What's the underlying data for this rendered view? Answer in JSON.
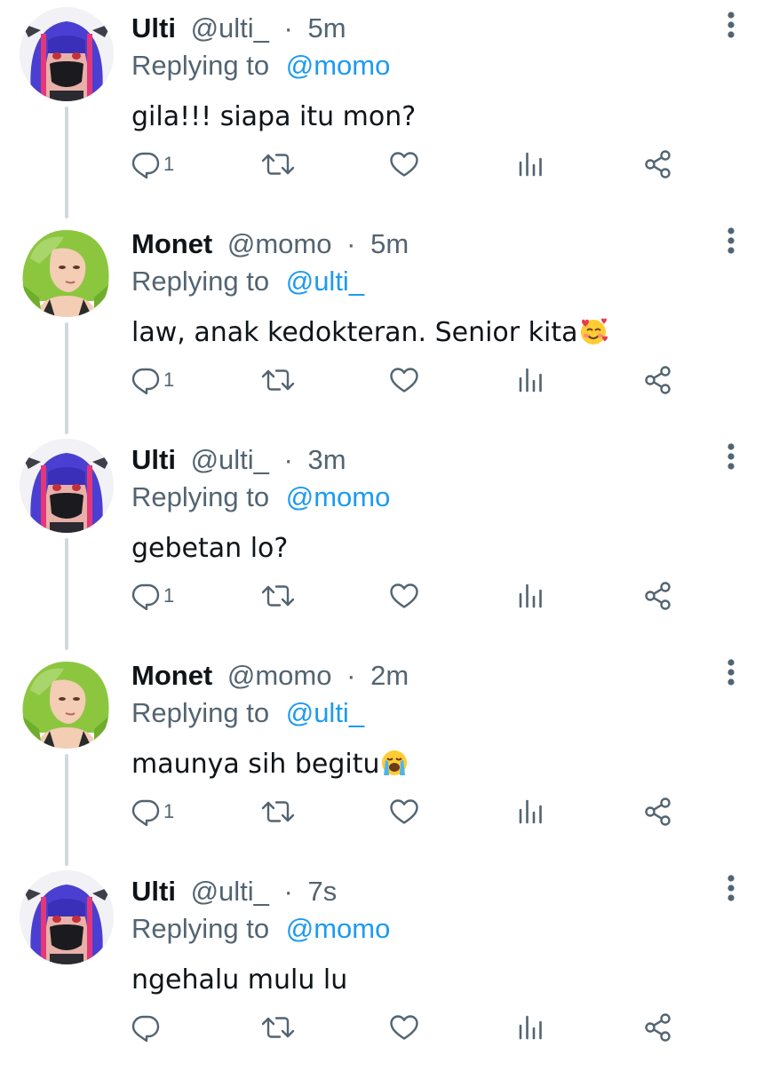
{
  "colors": {
    "text": "#0f1419",
    "secondary": "#536471",
    "accent": "#1d9bf0",
    "thread_line": "#cfd9de"
  },
  "replying_prefix": "Replying to",
  "tweets": [
    {
      "name": "Ulti",
      "handle": "@ulti_",
      "dot": "·",
      "time": "5m",
      "reply_to": "@momo",
      "text": "gila!!! siapa itu mon?",
      "emoji": "",
      "reply_count": "1",
      "avatar": "ulti-avatar"
    },
    {
      "name": "Monet",
      "handle": "@momo",
      "dot": "·",
      "time": "5m",
      "reply_to": "@ulti_",
      "text": "law, anak kedokteran. Senior kita",
      "emoji": "smiling-face-with-hearts-emoji",
      "reply_count": "1",
      "avatar": "monet-avatar"
    },
    {
      "name": "Ulti",
      "handle": "@ulti_",
      "dot": "·",
      "time": "3m",
      "reply_to": "@momo",
      "text": "gebetan lo?",
      "emoji": "",
      "reply_count": "1",
      "avatar": "ulti-avatar"
    },
    {
      "name": "Monet",
      "handle": "@momo",
      "dot": "·",
      "time": "2m",
      "reply_to": "@ulti_",
      "text": "maunya sih begitu",
      "emoji": "loudly-crying-face-emoji",
      "reply_count": "1",
      "avatar": "monet-avatar"
    },
    {
      "name": "Ulti",
      "handle": "@ulti_",
      "dot": "·",
      "time": "7s",
      "reply_to": "@momo",
      "text": "ngehalu mulu lu",
      "emoji": "",
      "reply_count": "",
      "avatar": "ulti-avatar"
    }
  ],
  "icons": {
    "reply": "reply-icon",
    "retweet": "retweet-icon",
    "like": "heart-icon",
    "stats": "analytics-icon",
    "share": "share-icon",
    "more": "more-vertical-icon"
  }
}
